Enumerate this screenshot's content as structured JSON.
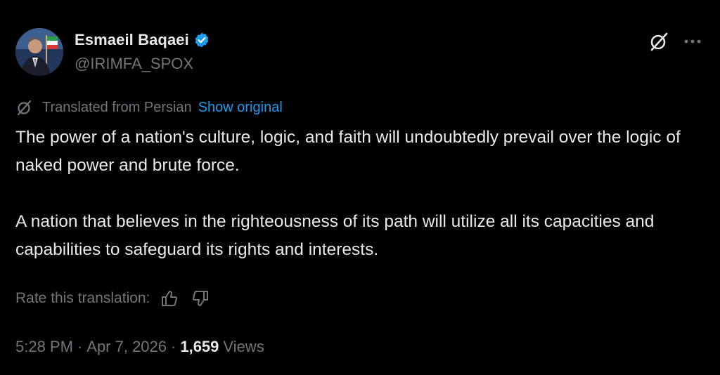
{
  "author": {
    "display_name": "Esmaeil Baqaei",
    "handle": "@IRIMFA_SPOX",
    "verified": true,
    "verified_color": "#1d9bf0"
  },
  "header_actions": {
    "grok_icon": "grok-slash-icon",
    "more_icon": "more-horizontal-icon"
  },
  "translation": {
    "label": "Translated from Persian",
    "show_original": "Show original",
    "rate_label": "Rate this translation:"
  },
  "body": {
    "paragraph_1": "The power of a nation's culture, logic, and faith will undoubtedly prevail over the logic of naked power and brute force.",
    "paragraph_2": "A nation that believes in the righteousness of its path will utilize all its capacities and capabilities to safeguard its rights and interests."
  },
  "meta": {
    "time": "5:28 PM",
    "separator": "·",
    "date": "Apr 7, 2026",
    "views_count": "1,659",
    "views_label": "Views"
  },
  "colors": {
    "background": "#000000",
    "primary_text": "#e7e9ea",
    "secondary_text": "#71767b",
    "link": "#1d9bf0"
  }
}
